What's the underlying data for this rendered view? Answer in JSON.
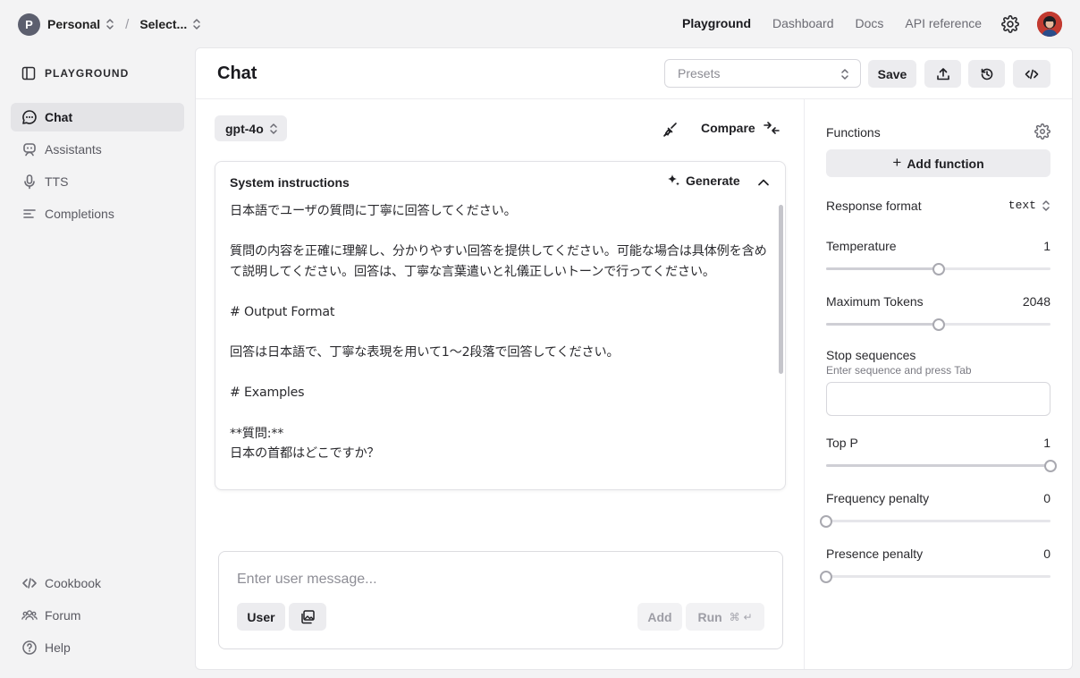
{
  "topbar": {
    "org_initial": "P",
    "org_name": "Personal",
    "project_name": "Select...",
    "nav": [
      {
        "label": "Playground",
        "active": true
      },
      {
        "label": "Dashboard",
        "active": false
      },
      {
        "label": "Docs",
        "active": false
      },
      {
        "label": "API reference",
        "active": false
      }
    ]
  },
  "sidebar": {
    "heading": "PLAYGROUND",
    "items": [
      {
        "label": "Chat",
        "icon": "chat-bubble-icon",
        "active": true
      },
      {
        "label": "Assistants",
        "icon": "robot-icon",
        "active": false
      },
      {
        "label": "TTS",
        "icon": "microphone-icon",
        "active": false
      },
      {
        "label": "Completions",
        "icon": "text-lines-icon",
        "active": false
      }
    ],
    "footer_items": [
      {
        "label": "Cookbook",
        "icon": "code-icon"
      },
      {
        "label": "Forum",
        "icon": "people-icon"
      },
      {
        "label": "Help",
        "icon": "question-icon"
      }
    ]
  },
  "header": {
    "title": "Chat",
    "presets_placeholder": "Presets",
    "save_label": "Save",
    "upload_icon": "upload-icon",
    "history_icon": "history-icon",
    "code_icon": "code-icon"
  },
  "chat": {
    "model": "gpt-4o",
    "compare_label": "Compare",
    "system_title": "System instructions",
    "generate_label": "Generate",
    "system_text": "日本語でユーザの質問に丁寧に回答してください。\n\n質問の内容を正確に理解し、分かりやすい回答を提供してください。可能な場合は具体例を含めて説明してください。回答は、丁寧な言葉遣いと礼儀正しいトーンで行ってください。\n\n# Output Format\n\n回答は日本語で、丁寧な表現を用いて1〜2段落で回答してください。\n\n# Examples\n\n**質問:**\n日本の首都はどこですか？",
    "composer_placeholder": "Enter user message...",
    "role_label": "User",
    "add_label": "Add",
    "run_label": "Run",
    "run_shortcut": "⌘ ↵"
  },
  "settings": {
    "functions_label": "Functions",
    "add_function_label": "Add function",
    "response_format_label": "Response format",
    "response_format_value": "text",
    "stop_label": "Stop sequences",
    "stop_hint": "Enter sequence and press Tab",
    "sliders": [
      {
        "key": "temperature",
        "label": "Temperature",
        "display": "1",
        "fraction": 0.5
      },
      {
        "key": "max_tokens",
        "label": "Maximum Tokens",
        "display": "2048",
        "fraction": 0.5
      },
      {
        "key": "top_p",
        "label": "Top P",
        "display": "1",
        "fraction": 1.0
      },
      {
        "key": "frequency_penalty",
        "label": "Frequency penalty",
        "display": "0",
        "fraction": 0.0
      },
      {
        "key": "presence_penalty",
        "label": "Presence penalty",
        "display": "0",
        "fraction": 0.0
      }
    ]
  }
}
